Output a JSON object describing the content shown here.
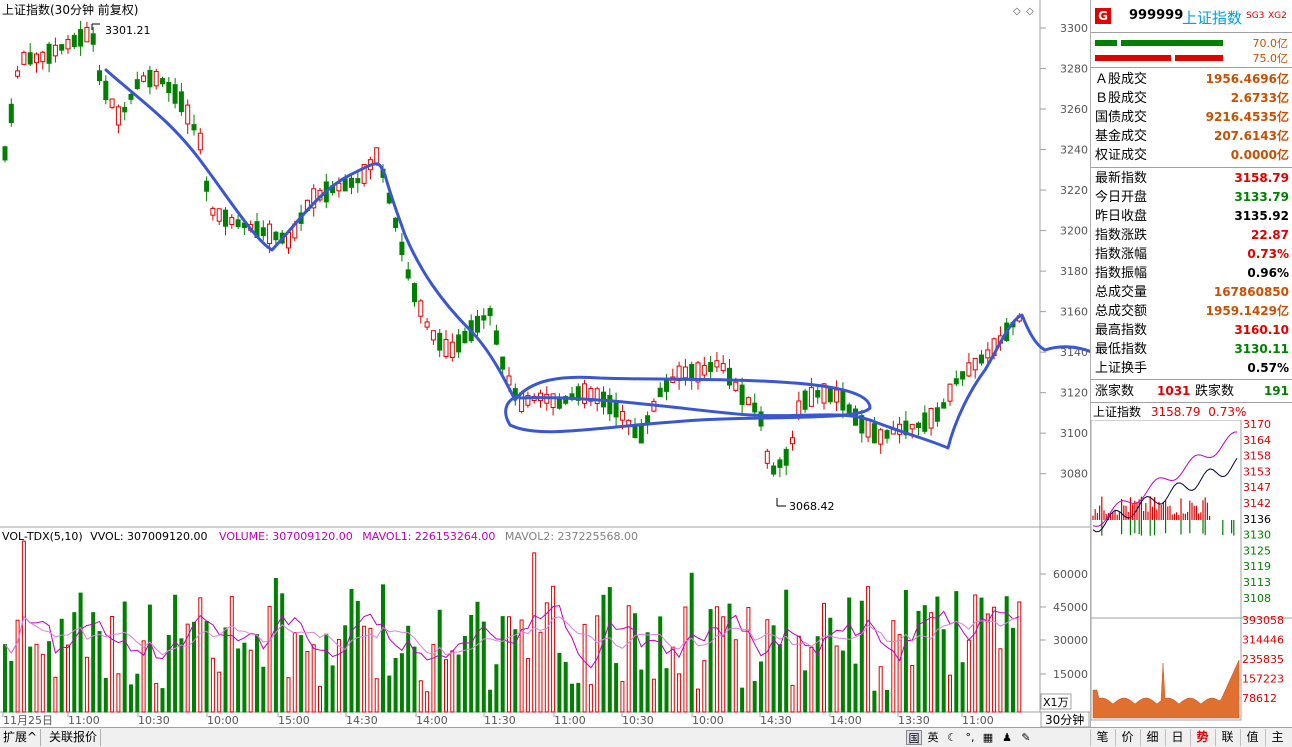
{
  "main_chart": {
    "title": "上证指数(30分钟 前复权)",
    "high_label": "3301.21",
    "low_label": "3068.42",
    "y_ticks": [
      "3300",
      "3280",
      "3260",
      "3240",
      "3220",
      "3200",
      "3180",
      "3160",
      "3140",
      "3120",
      "3100",
      "3080"
    ]
  },
  "volume_chart": {
    "legend": {
      "name": "VOL-TDX(5,10)",
      "vvol": "VVOL: 307009120.00",
      "volume": "VOLUME: 307009120.00",
      "mavol1": "MAVOL1: 226153264.00",
      "mavol2": "MAVOL2: 237225568.00"
    },
    "y_ticks": [
      "60000",
      "45000",
      "30000",
      "15000"
    ],
    "unit": "X1万"
  },
  "x_axis": {
    "labels": [
      "11月25日",
      "11:00",
      "10:30",
      "10:00",
      "15:00",
      "14:30",
      "14:00",
      "11:30",
      "11:00",
      "10:30",
      "10:00",
      "14:30",
      "14:00",
      "13:30",
      "11:00"
    ],
    "period": "30分钟"
  },
  "quote_panel": {
    "badge": "G",
    "code": "999999",
    "name": "上证指数",
    "tags": [
      "SG3",
      "XG2"
    ],
    "bar1_value": "70.0亿",
    "bar2_value": "75.0亿",
    "turnover": [
      {
        "label": "Ａ股成交",
        "value": "1956.4696亿"
      },
      {
        "label": "Ｂ股成交",
        "value": "2.6733亿"
      },
      {
        "label": "国债成交",
        "value": "9216.4535亿"
      },
      {
        "label": "基金成交",
        "value": "207.6143亿"
      },
      {
        "label": "权证成交",
        "value": "0.0000亿"
      }
    ],
    "stats": [
      {
        "label": "最新指数",
        "value": "3158.79",
        "color": "red"
      },
      {
        "label": "今日开盘",
        "value": "3133.79",
        "color": "green"
      },
      {
        "label": "昨日收盘",
        "value": "3135.92",
        "color": "black"
      },
      {
        "label": "指数涨跌",
        "value": "22.87",
        "color": "red"
      },
      {
        "label": "指数涨幅",
        "value": "0.73%",
        "color": "red"
      },
      {
        "label": "指数振幅",
        "value": "0.96%",
        "color": "black"
      },
      {
        "label": "总成交量",
        "value": "167860850",
        "color": "orange"
      },
      {
        "label": "总成交额",
        "value": "1959.1429亿",
        "color": "orange"
      },
      {
        "label": "最高指数",
        "value": "3160.10",
        "color": "red"
      },
      {
        "label": "最低指数",
        "value": "3130.11",
        "color": "green"
      },
      {
        "label": "上证换手",
        "value": "0.57%",
        "color": "black"
      }
    ],
    "breadth": {
      "up_label": "涨家数",
      "up_value": "1031",
      "down_label": "跌家数",
      "down_value": "191"
    }
  },
  "mini_chart": {
    "title": "上证指数",
    "price": "3158.79",
    "pct": "0.73%",
    "price_ticks": [
      "3170",
      "3164",
      "3158",
      "3153",
      "3147",
      "3142",
      "3136",
      "3130",
      "3125",
      "3119",
      "3113",
      "3108"
    ],
    "volume_ticks": [
      "393058",
      "314446",
      "235835",
      "157223",
      "78612"
    ]
  },
  "bottom_bar": {
    "left_buttons": [
      "扩展^",
      "关联报价"
    ],
    "tool_icons": [
      "国",
      "英"
    ],
    "right_tabs": [
      "笔",
      "价",
      "细",
      "日",
      "势",
      "联",
      "值",
      "主"
    ],
    "active_tab": "势"
  },
  "colors": {
    "up": "#e00000",
    "down": "#008000",
    "annotation": "#3a56d0",
    "ma1": "#c000c0",
    "ma2": "#e080e0"
  }
}
